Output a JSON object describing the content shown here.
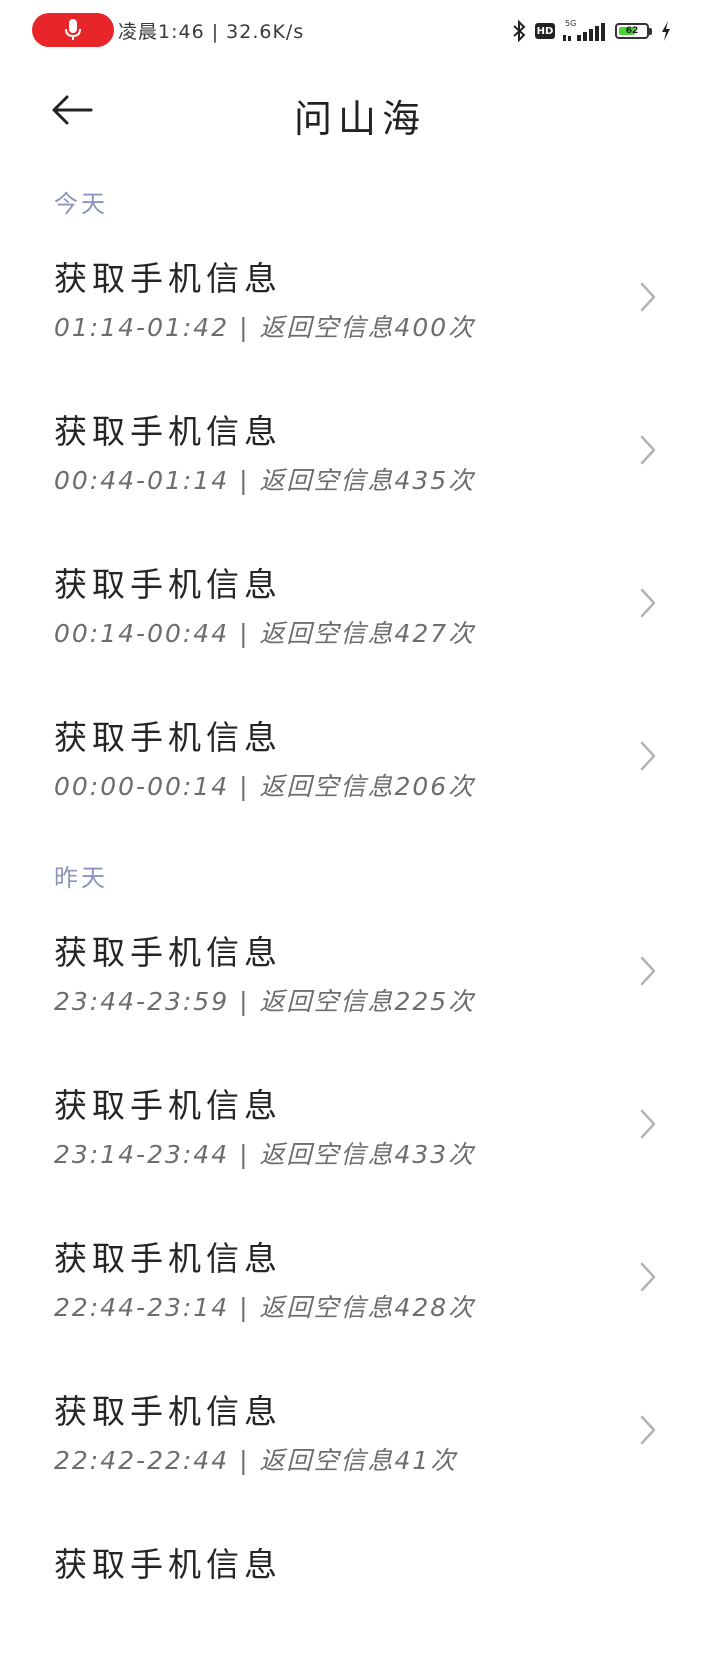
{
  "status_bar": {
    "time": "凌晨1:46",
    "net_speed": "32.6K/s",
    "signal_label": "5G",
    "battery_level": "62",
    "battery_fraction": 0.62,
    "accent_mic": "#e8262a",
    "battery_color": "#4cd137"
  },
  "header": {
    "title": "问山海",
    "back_icon": "arrow-left-icon"
  },
  "sections": [
    {
      "label": "今天",
      "items": [
        {
          "title": "获取手机信息",
          "range": "01:14-01:42",
          "note": "返回空信息400次"
        },
        {
          "title": "获取手机信息",
          "range": "00:44-01:14",
          "note": "返回空信息435次"
        },
        {
          "title": "获取手机信息",
          "range": "00:14-00:44",
          "note": "返回空信息427次"
        },
        {
          "title": "获取手机信息",
          "range": "00:00-00:14",
          "note": "返回空信息206次"
        }
      ]
    },
    {
      "label": "昨天",
      "items": [
        {
          "title": "获取手机信息",
          "range": "23:44-23:59",
          "note": "返回空信息225次"
        },
        {
          "title": "获取手机信息",
          "range": "23:14-23:44",
          "note": "返回空信息433次"
        },
        {
          "title": "获取手机信息",
          "range": "22:44-23:14",
          "note": "返回空信息428次"
        },
        {
          "title": "获取手机信息",
          "range": "22:42-22:44",
          "note": "返回空信息41次"
        },
        {
          "title": "获取手机信息",
          "range": "",
          "note": ""
        }
      ]
    }
  ],
  "colors": {
    "section_label": "#8c95bd",
    "subtitle": "#6d6d6d",
    "chevron": "#b3b3b3"
  }
}
